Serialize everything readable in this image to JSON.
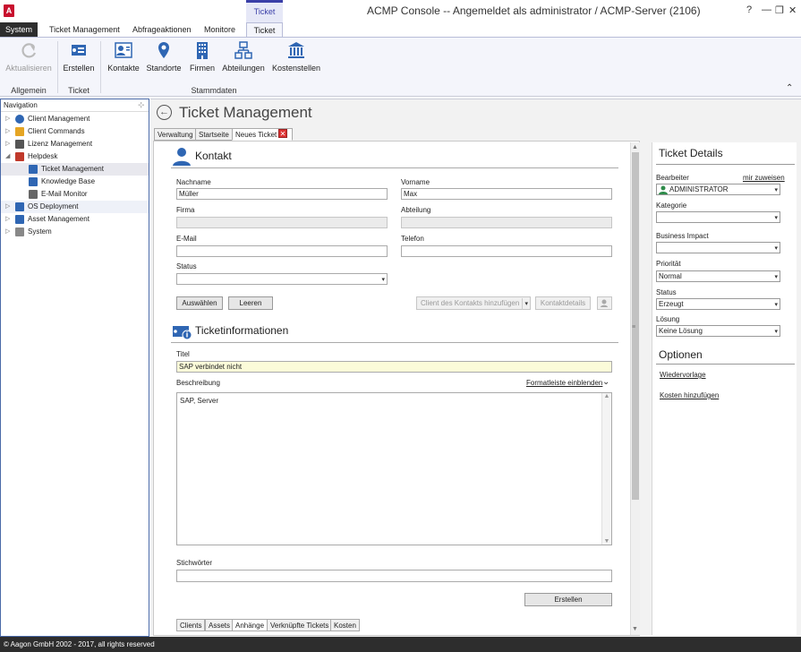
{
  "window": {
    "title": "ACMP Console -- Angemeldet als administrator / ACMP-Server (2106)",
    "context_tab": "Ticket",
    "help": "?",
    "minimize": "—",
    "restore": "❐",
    "close": "✕"
  },
  "menu": {
    "tabs": [
      "System",
      "Ticket Management",
      "Abfrageaktionen",
      "Monitore",
      "Ticket"
    ],
    "active": "Ticket"
  },
  "ribbon": {
    "buttons": {
      "aktualisieren": "Aktualisieren",
      "erstellen": "Erstellen",
      "kontakte": "Kontakte",
      "standorte": "Standorte",
      "firmen": "Firmen",
      "abteilungen": "Abteilungen",
      "kostenstellen": "Kostenstellen"
    },
    "groups": {
      "allgemein": "Allgemein",
      "ticket": "Ticket",
      "stammdaten": "Stammdaten"
    },
    "collapse": "⌃"
  },
  "navigation": {
    "header": "Navigation",
    "pin": "⊹",
    "items": [
      {
        "label": "Client Management",
        "level": 0,
        "icon": "client-management-icon"
      },
      {
        "label": "Client Commands",
        "level": 0,
        "icon": "puzzle-icon"
      },
      {
        "label": "Lizenz Management",
        "level": 0,
        "icon": "license-icon"
      },
      {
        "label": "Helpdesk",
        "level": 0,
        "icon": "helpdesk-icon",
        "expanded": true
      },
      {
        "label": "Ticket Management",
        "level": 1,
        "icon": "ticket-icon",
        "selected": true
      },
      {
        "label": "Knowledge Base",
        "level": 1,
        "icon": "book-icon"
      },
      {
        "label": "E-Mail Monitor",
        "level": 1,
        "icon": "mail-icon"
      },
      {
        "label": "OS Deployment",
        "level": 0,
        "icon": "os-deployment-icon"
      },
      {
        "label": "Asset Management",
        "level": 0,
        "icon": "asset-icon"
      },
      {
        "label": "System",
        "level": 0,
        "icon": "system-icon"
      }
    ]
  },
  "main": {
    "title": "Ticket Management",
    "doc_tabs": [
      "Verwaltung",
      "Startseite",
      "Neues Ticket"
    ],
    "active_doc_tab": "Neues Ticket",
    "close_glyph": "✕"
  },
  "kontakt": {
    "title": "Kontakt",
    "nachname_label": "Nachname",
    "nachname_value": "Müller",
    "vorname_label": "Vorname",
    "vorname_value": "Max",
    "firma_label": "Firma",
    "firma_value": "",
    "abteilung_label": "Abteilung",
    "abteilung_value": "",
    "email_label": "E-Mail",
    "email_value": "",
    "telefon_label": "Telefon",
    "telefon_value": "",
    "status_label": "Status",
    "status_value": "",
    "btn_auswaehlen": "Auswählen",
    "btn_leeren": "Leeren",
    "btn_client_hinzufuegen": "Client des Kontakts hinzufügen",
    "btn_kontaktdetails": "Kontaktdetails"
  },
  "ticketinfo": {
    "title": "Ticketinformationen",
    "titel_label": "Titel",
    "titel_value": "SAP verbindet nicht",
    "beschreibung_label": "Beschreibung",
    "formatleiste_link": "Formatleiste einblenden",
    "beschreibung_value": "SAP, Server",
    "stichwoerter_label": "Stichwörter",
    "stichwoerter_value": "",
    "btn_erstellen": "Erstellen"
  },
  "bottom_tabs": [
    "Clients",
    "Assets",
    "Anhänge",
    "Verknüpfte Tickets",
    "Kosten"
  ],
  "active_bottom_tab": "Anhänge",
  "details": {
    "title": "Ticket Details",
    "bearbeiter_label": "Bearbeiter",
    "mir_zuweisen": "mir zuweisen",
    "bearbeiter_value": "ADMINISTRATOR",
    "kategorie_label": "Kategorie",
    "kategorie_value": "",
    "business_impact_label": "Business Impact",
    "business_impact_value": "",
    "prioritaet_label": "Priorität",
    "prioritaet_value": "Normal",
    "status_label": "Status",
    "status_value": "Erzeugt",
    "loesung_label": "Lösung",
    "loesung_value": "Keine Lösung",
    "optionen_title": "Optionen",
    "wiedervorlage": "Wiedervorlage",
    "kosten_hinzufuegen": "Kosten hinzufügen"
  },
  "statusbar": {
    "text": "© Aagon GmbH 2002 - 2017, all rights reserved"
  },
  "colors": {
    "accent": "#3a3fa8",
    "ribbon_icon": "#2f66b3",
    "dark": "#2d2d2d",
    "highlight_field": "#fbfbd9"
  }
}
